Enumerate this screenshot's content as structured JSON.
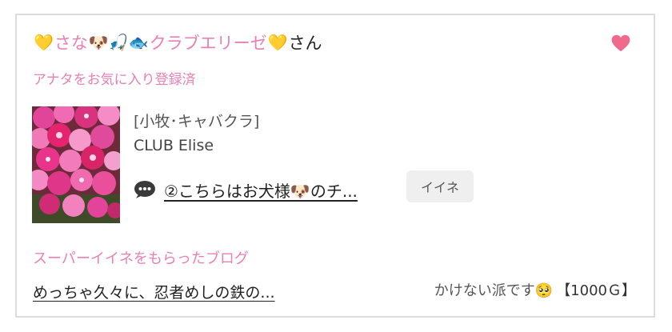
{
  "card": {
    "user": {
      "prefix_emoji": "💛",
      "name_part1": "さな",
      "name_emojis": "🐶🎣🐟",
      "name_part2": "クラブエリーゼ",
      "suffix_emoji": "💛",
      "honorific": "さん"
    },
    "favorite_icon": "heart-icon",
    "favorite_note": "アナタをお気に入り登録済",
    "shop": {
      "category": "[小牧･キャバクラ]",
      "name": "CLUB Elise"
    },
    "message": {
      "icon": "speech-bubble-icon",
      "text": "②こちらはお犬様🐶のチ..."
    },
    "iine_button": "イイネ",
    "super_iine": {
      "heading": "スーパーイイネをもらったブログ",
      "blog_title": "めっちゃ久々に、忍者めしの鉄の...",
      "comment": "かけない派です🥺",
      "amount": "【1000Ｇ】"
    },
    "colors": {
      "accent_pink": "#e780b6",
      "heart": "#f06a8e",
      "button_bg": "#efefef",
      "border": "#dcdcdc"
    }
  }
}
